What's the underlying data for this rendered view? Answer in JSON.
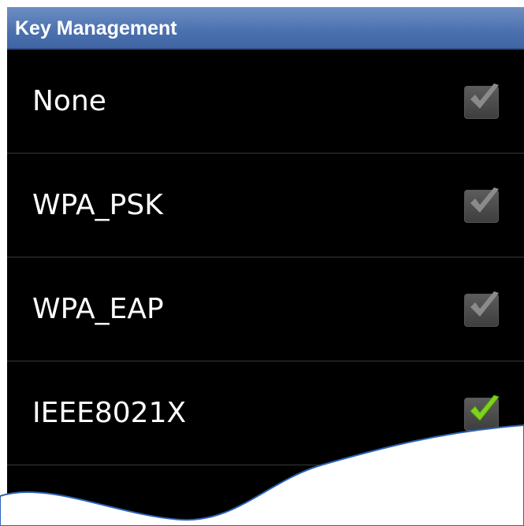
{
  "dialog": {
    "title": "Key Management"
  },
  "options": [
    {
      "label": "None",
      "checked": true,
      "enabled": false
    },
    {
      "label": "WPA_PSK",
      "checked": true,
      "enabled": false
    },
    {
      "label": "WPA_EAP",
      "checked": true,
      "enabled": false
    },
    {
      "label": "IEEE8021X",
      "checked": true,
      "enabled": true
    }
  ],
  "colors": {
    "title_bar": "#4a70ae",
    "background": "#000000",
    "check_active": "#7fd31b",
    "check_disabled": "#8a8a8a"
  },
  "icons": {
    "checkbox": "checkmark-icon"
  }
}
